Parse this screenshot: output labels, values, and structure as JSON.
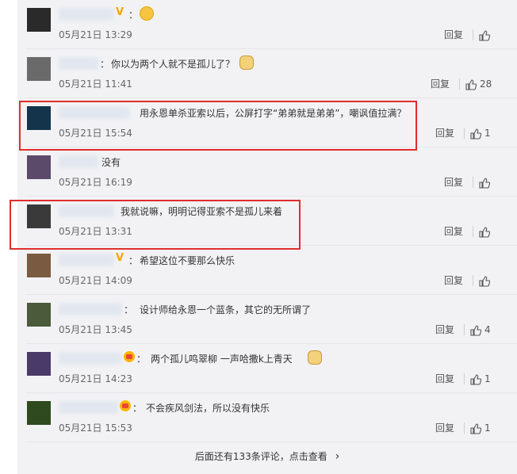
{
  "comments": [
    {
      "suffix": "：",
      "text": "",
      "time": "05月21日 13:29",
      "reply": "回复",
      "likes": "",
      "badge": "v",
      "emoji": "grin",
      "avatar": "#2a2a2a",
      "name_w": 70
    },
    {
      "suffix": "：",
      "text": "你以为两个人就不是孤儿了？",
      "time": "05月21日 11:41",
      "reply": "回复",
      "likes": "28",
      "badge": "",
      "emoji": "dog",
      "avatar": "#6a6a6a",
      "name_w": 50
    },
    {
      "suffix": "",
      "text": "用永恩单杀亚索以后，公屏打字“弟弟就是弟弟”，嘲讽值拉满？",
      "time": "05月21日 15:54",
      "reply": "回复",
      "likes": "1",
      "badge": "",
      "emoji": "",
      "avatar": "#13344a",
      "name_w": 90
    },
    {
      "suffix": "",
      "text": "没有",
      "time": "05月21日 16:19",
      "reply": "回复",
      "likes": "",
      "badge": "",
      "emoji": "",
      "avatar": "#5c4a6a",
      "name_w": 50
    },
    {
      "suffix": "",
      "text": "我就说嘛，明明记得亚索不是孤儿来着",
      "time": "05月21日 13:31",
      "reply": "回复",
      "likes": "",
      "badge": "",
      "emoji": "",
      "avatar": "#3a3a3a",
      "name_w": 70
    },
    {
      "suffix": "：",
      "text": "希望这位不要那么快乐",
      "time": "05月21日 14:09",
      "reply": "回复",
      "likes": "",
      "badge": "v",
      "emoji": "",
      "avatar": "#7a5a40",
      "name_w": 70
    },
    {
      "suffix": "：",
      "text": "设计师给永恩一个蓝条，其它的无所谓了",
      "time": "05月21日 13:45",
      "reply": "回复",
      "likes": "4",
      "badge": "",
      "emoji": "",
      "avatar": "#4a5a3a",
      "name_w": 80
    },
    {
      "suffix": "：",
      "text": "两个孤儿鸣翠柳 一声哈撒k上青天",
      "time": "05月21日 14:23",
      "reply": "回复",
      "likes": "1",
      "badge": "crown",
      "emoji": "dog",
      "avatar": "#4a3a6a",
      "name_w": 80
    },
    {
      "suffix": "：",
      "text": "不会疾风剑法，所以没有快乐",
      "time": "05月21日 15:53",
      "reply": "回复",
      "likes": "1",
      "badge": "crown",
      "emoji": "",
      "avatar": "#2f4a1f",
      "name_w": 75
    }
  ],
  "footer": {
    "more_text": "后面还有133条评论，点击查看",
    "chevron": "›"
  }
}
